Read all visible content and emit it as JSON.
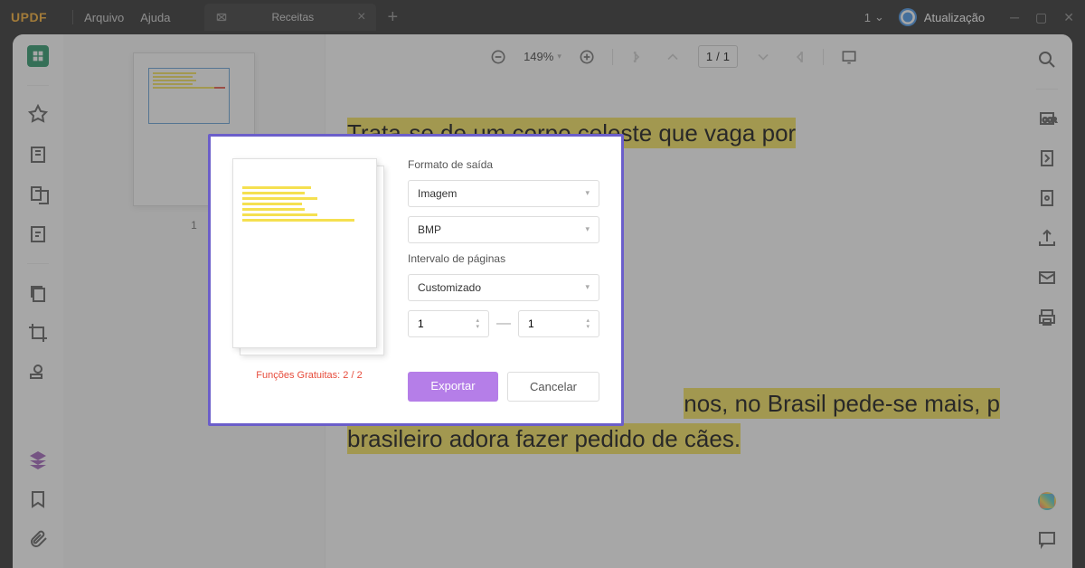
{
  "titlebar": {
    "logo": "UPDF",
    "menu_arquivo": "Arquivo",
    "menu_ajuda": "Ajuda",
    "tab_label": "Receitas",
    "counter": "1",
    "update_text": "Atualização"
  },
  "toolbar": {
    "zoom": "149%",
    "page_current": "1",
    "page_sep": "/",
    "page_total": "1"
  },
  "thumbnail": {
    "page_num": "1"
  },
  "document": {
    "line1": "Trata-se de um corpo celeste que vaga por",
    "line2": "nos, no Brasil pede-se mais, p",
    "line3": "brasileiro adora fazer pedido de cães."
  },
  "dialog": {
    "format_label": "Formato de saída",
    "format_value": "Imagem",
    "filetype_value": "BMP",
    "range_label": "Intervalo de páginas",
    "range_value": "Customizado",
    "range_from": "1",
    "range_to": "1",
    "free_text": "Funções Gratuitas: 2 / 2",
    "export_btn": "Exportar",
    "cancel_btn": "Cancelar"
  }
}
